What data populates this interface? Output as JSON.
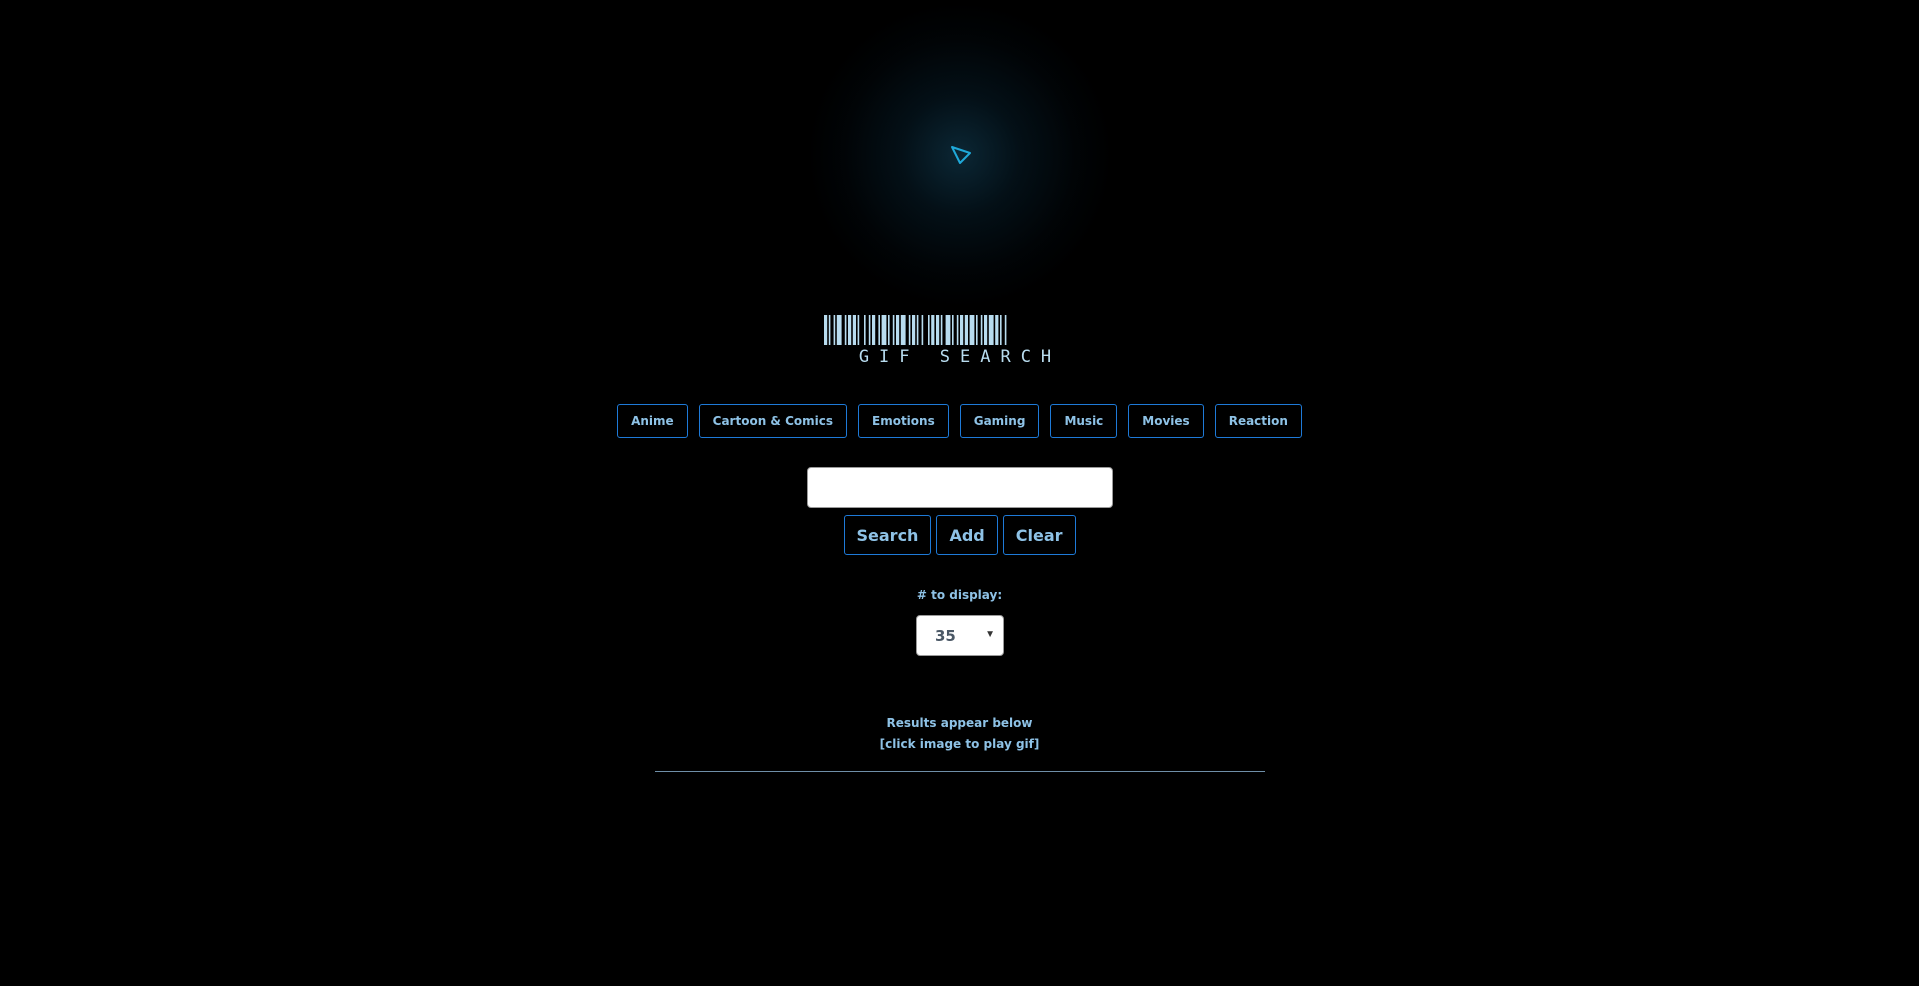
{
  "logo": {
    "text": "GIF SEARCH"
  },
  "categories": [
    {
      "label": "Anime"
    },
    {
      "label": "Cartoon & Comics"
    },
    {
      "label": "Emotions"
    },
    {
      "label": "Gaming"
    },
    {
      "label": "Music"
    },
    {
      "label": "Movies"
    },
    {
      "label": "Reaction"
    }
  ],
  "search": {
    "value": "",
    "placeholder": ""
  },
  "actions": {
    "search_label": "Search",
    "add_label": "Add",
    "clear_label": "Clear"
  },
  "display": {
    "label": "# to display:",
    "selected": "35"
  },
  "results": {
    "line1": "Results appear below",
    "line2": "[click image to play gif]"
  },
  "colors": {
    "background": "#000000",
    "accent_border": "#1e7ad8",
    "text": "#8ec2e6",
    "play_icon": "#1fa8d8"
  },
  "icons": {
    "play": "play-triangle-icon",
    "dropdown": "caret-down-icon"
  }
}
